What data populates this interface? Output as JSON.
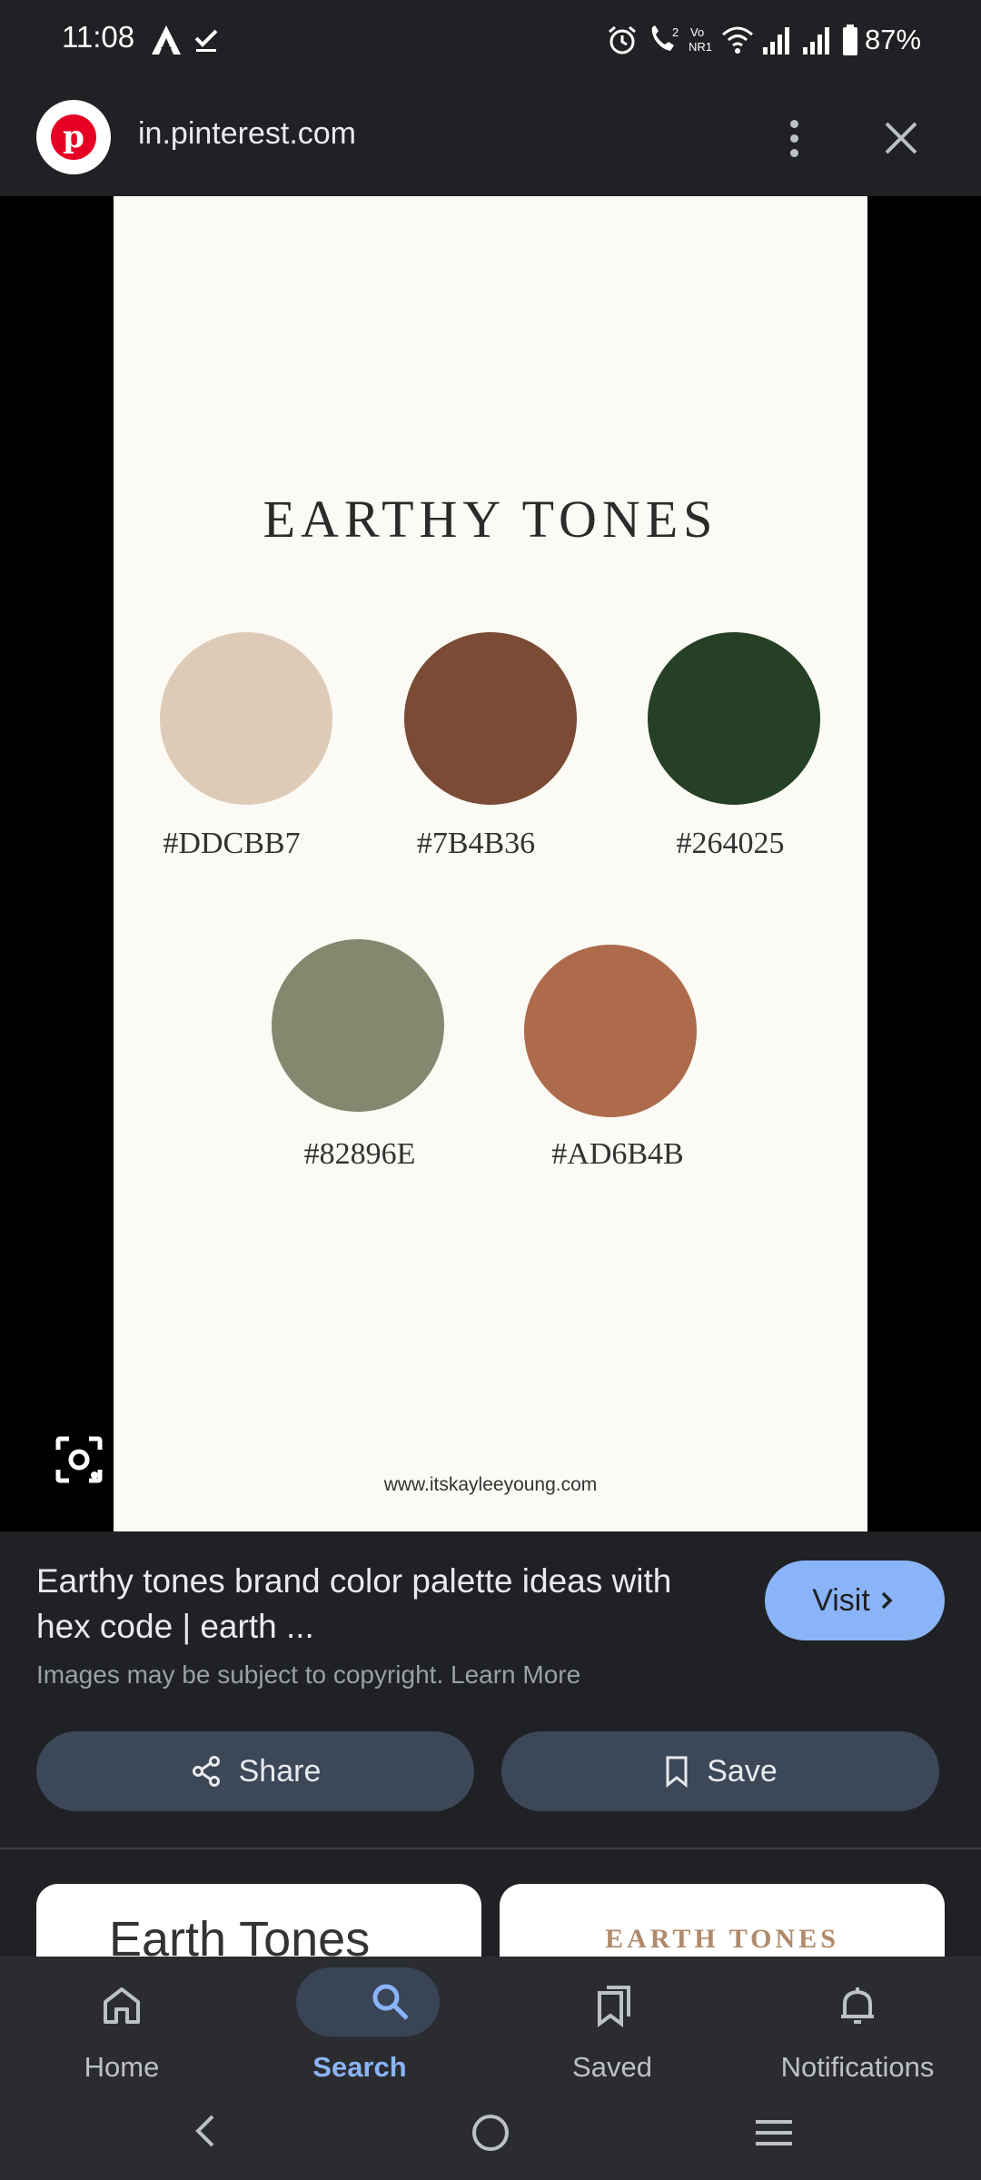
{
  "status_bar": {
    "time": "11:08",
    "battery": "87%",
    "icons": [
      "app-a-icon",
      "check-icon",
      "alarm-icon",
      "wifi-calling-icon",
      "volte-icon",
      "wifi-icon",
      "signal-icon",
      "signal-icon",
      "battery-icon"
    ]
  },
  "header": {
    "site_url": "in.pinterest.com",
    "logo_letter": "p"
  },
  "image": {
    "title": "EARTHY TONES",
    "swatches": [
      {
        "hex": "#DDCBB7",
        "color": "#DDCBB7"
      },
      {
        "hex": "#7B4B36",
        "color": "#7B4B36"
      },
      {
        "hex": "#264025",
        "color": "#264025"
      },
      {
        "hex": "#82896E",
        "color": "#82896E"
      },
      {
        "hex": "#AD6B4B",
        "color": "#AD6B4B"
      }
    ],
    "source_url": "www.itskayleeyoung.com"
  },
  "result": {
    "title": "Earthy tones brand color palette ideas with hex code | earth ...",
    "copyright": "Images may be subject to copyright. Learn More",
    "visit_label": "Visit",
    "share_label": "Share",
    "save_label": "Save"
  },
  "related": [
    {
      "text": "Earth Tones"
    },
    {
      "text": "EARTH TONES"
    }
  ],
  "nav": {
    "home": "Home",
    "search": "Search",
    "saved": "Saved",
    "notifications": "Notifications"
  },
  "colors": {
    "accent": "#8ab4f8",
    "background": "#202124",
    "pinterest_red": "#e60023"
  }
}
